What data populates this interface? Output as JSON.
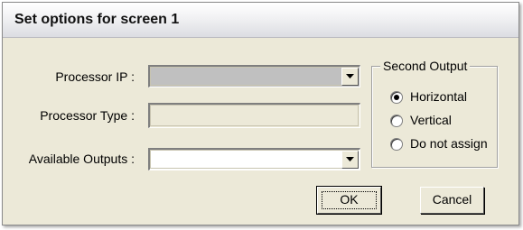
{
  "dialog": {
    "title": "Set options for screen 1"
  },
  "form": {
    "processor_ip_label": "Processor IP :",
    "processor_ip_value": "",
    "processor_type_label": "Processor Type :",
    "processor_type_value": "",
    "available_outputs_label": "Available Outputs :",
    "available_outputs_value": ""
  },
  "second_output": {
    "legend": "Second Output",
    "options": [
      {
        "label": "Horizontal",
        "selected": true
      },
      {
        "label": "Vertical",
        "selected": false
      },
      {
        "label": "Do not assign",
        "selected": false
      }
    ]
  },
  "buttons": {
    "ok_label": "OK",
    "cancel_label": "Cancel"
  },
  "icons": {
    "dropdown": "chevron-down-icon"
  }
}
